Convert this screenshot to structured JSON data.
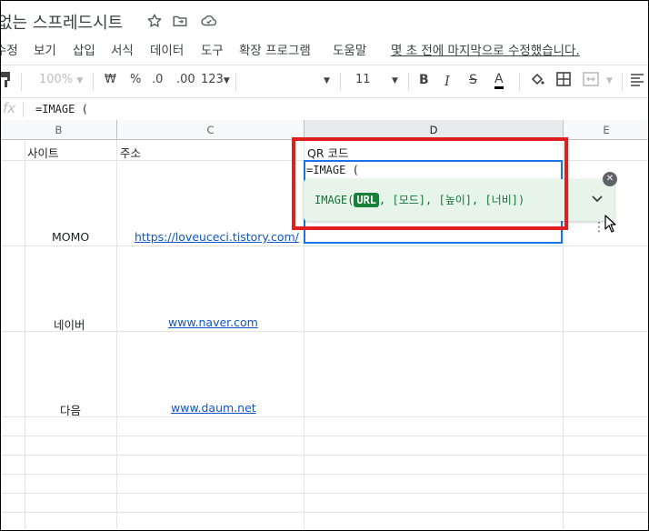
{
  "doc": {
    "title": "없는 스프레드시트"
  },
  "menu": {
    "items": [
      "수정",
      "보기",
      "삽입",
      "서식",
      "데이터",
      "도구",
      "확장 프로그램",
      "도움말"
    ],
    "last_edit": "몇 초 전에 마지막으로 수정했습니다."
  },
  "toolbar": {
    "zoom": "100%",
    "currency": "₩",
    "percent": "%",
    "dec_less": ".0",
    "dec_more": ".00",
    "number_format": "123",
    "font_size": "11",
    "bold": "B",
    "italic": "I",
    "strike": "S",
    "text_color": "A"
  },
  "formula_bar": {
    "fx": "fx",
    "value": "=IMAGE ("
  },
  "columns": [
    "B",
    "C",
    "D",
    "E"
  ],
  "rows": [
    {
      "b": "사이트",
      "c": "주소",
      "d": "QR 코드"
    },
    {
      "b": "MOMO",
      "c": "https://loveuceci.tistory.com/"
    },
    {
      "b": "네이버",
      "c": "www.naver.com"
    },
    {
      "b": "다음",
      "c": "www.daum.net"
    }
  ],
  "editor": {
    "value": "=IMAGE (",
    "signature": {
      "fn": "IMAGE(",
      "active_arg": "URL",
      "rest": ", [모드], [높이], [너비])"
    }
  },
  "colors": {
    "highlight": "#e01e1e",
    "accent": "#1a73e8",
    "tooltip_bg": "#e6f4ea",
    "link": "#1155cc"
  }
}
